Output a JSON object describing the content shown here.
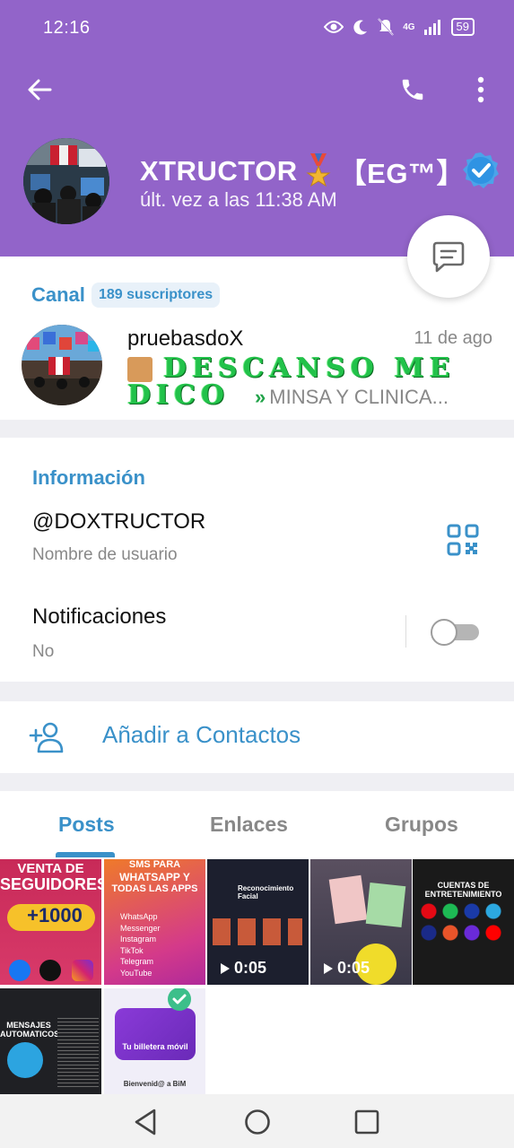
{
  "status_bar": {
    "time": "12:16",
    "net_label": "4G",
    "battery": "59"
  },
  "header": {
    "title": "XTRUCTOR",
    "title_suffix": "【EG™】",
    "last_seen": "últ. vez a las 11:38 AM",
    "colors": {
      "background": "#9264c9"
    }
  },
  "channel": {
    "section_label": "Canal",
    "subscribers": "189 suscriptores",
    "name": "pruebasdoX",
    "date": "11 de ago",
    "preview_deco_line1": "DESCANSO ME",
    "preview_deco_line2": "DICO",
    "preview_text": "MINSA Y CLINICA...",
    "preview_arrows": "»"
  },
  "info": {
    "section_label": "Información",
    "username": "@DOXTRUCTOR",
    "username_label": "Nombre de usuario",
    "notifications_label": "Notificaciones",
    "notifications_value": "No",
    "notifications_enabled": false
  },
  "contacts": {
    "add_label": "Añadir a Contactos"
  },
  "tabs": {
    "items": [
      {
        "label": "Posts",
        "active": true
      },
      {
        "label": "Enlaces",
        "active": false
      },
      {
        "label": "Grupos",
        "active": false
      }
    ]
  },
  "media": {
    "items": [
      {
        "text1": "VENTA DE",
        "text2": "SEGUIDORES",
        "text3": "+1000"
      },
      {
        "text1": "SMS PARA",
        "text2": "WHATSAPP Y",
        "text3": "TODAS LAS APPS",
        "list": [
          "WhatsApp",
          "Messenger",
          "Instagram",
          "TikTok",
          "Telegram",
          "YouTube"
        ]
      },
      {
        "title": "Reconocimiento Facial",
        "duration": "0:05"
      },
      {
        "duration": "0:05"
      },
      {
        "title": "CUENTAS DE ENTRETENIMIENTO"
      },
      {
        "title": "MENSAJES AUTOMATICOS"
      },
      {
        "title": "Tu billetera móvil",
        "footer": "Bienvenid@ a BiM"
      }
    ]
  },
  "accent": "#3a91c9"
}
